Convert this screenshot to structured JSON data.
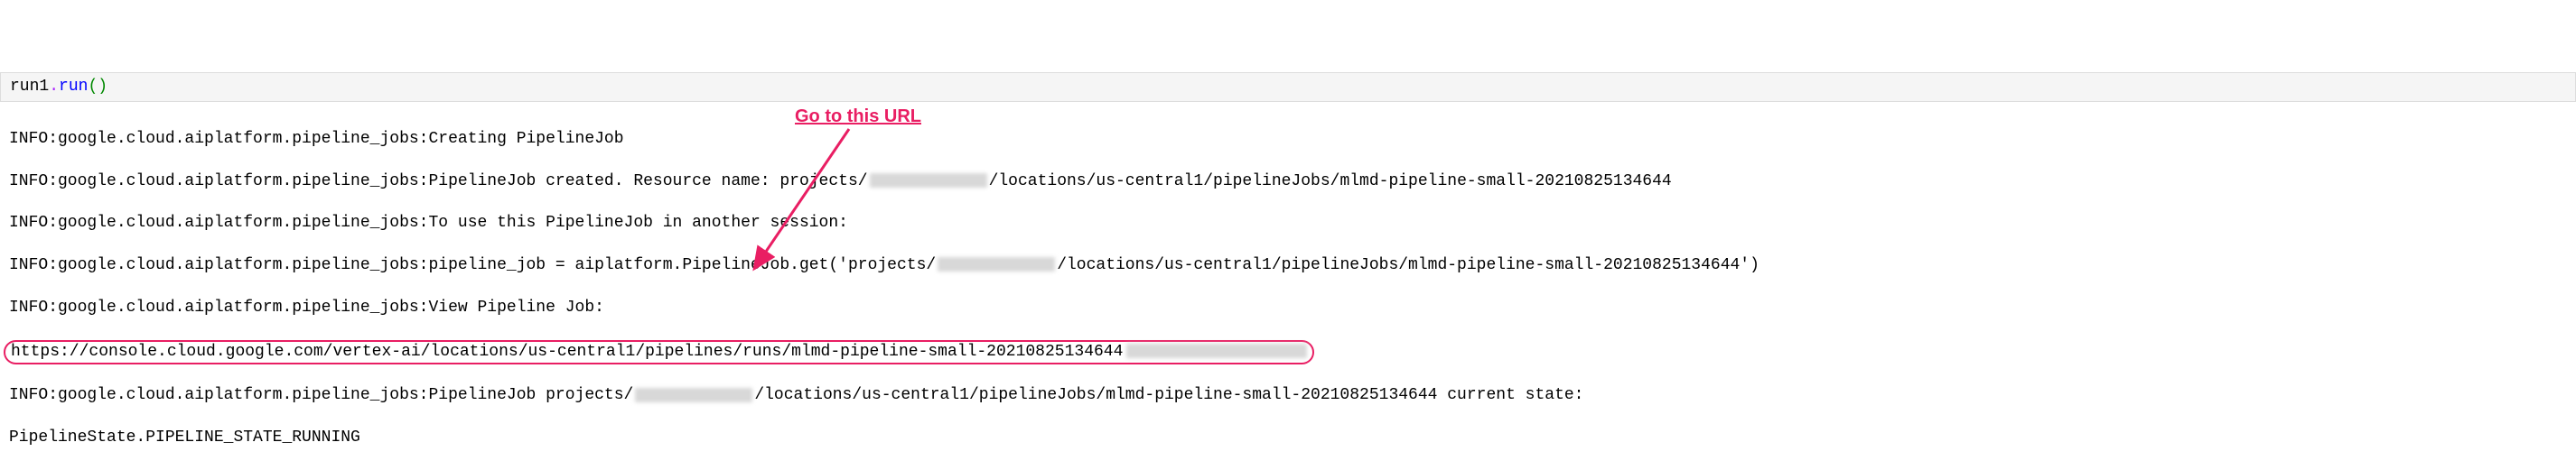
{
  "annotation": {
    "label": "Go to this URL",
    "color": "#e91e63"
  },
  "code": {
    "object": "run1",
    "method": "run",
    "parens": "()"
  },
  "log": {
    "prefix": "INFO:google.cloud.aiplatform.pipeline_jobs:",
    "lines": [
      {
        "text": "Creating PipelineJob"
      },
      {
        "text_prefix": "PipelineJob created. Resource name: projects/",
        "redacted": true,
        "text_suffix": "/locations/us-central1/pipelineJobs/mlmd-pipeline-small-20210825134644"
      },
      {
        "text": "To use this PipelineJob in another session:"
      },
      {
        "text_prefix": "pipeline_job = aiplatform.PipelineJob.get('projects/",
        "redacted": true,
        "text_suffix": "/locations/us-central1/pipelineJobs/mlmd-pipeline-small-20210825134644')"
      },
      {
        "text": "View Pipeline Job:"
      }
    ],
    "url_line": "https://console.cloud.google.com/vertex-ai/locations/us-central1/pipelines/runs/mlmd-pipeline-small-20210825134644",
    "final_line_prefix": "PipelineJob projects/",
    "final_line_suffix": "/locations/us-central1/pipelineJobs/mlmd-pipeline-small-20210825134644 current state:",
    "final_state": "PipelineState.PIPELINE_STATE_RUNNING"
  }
}
